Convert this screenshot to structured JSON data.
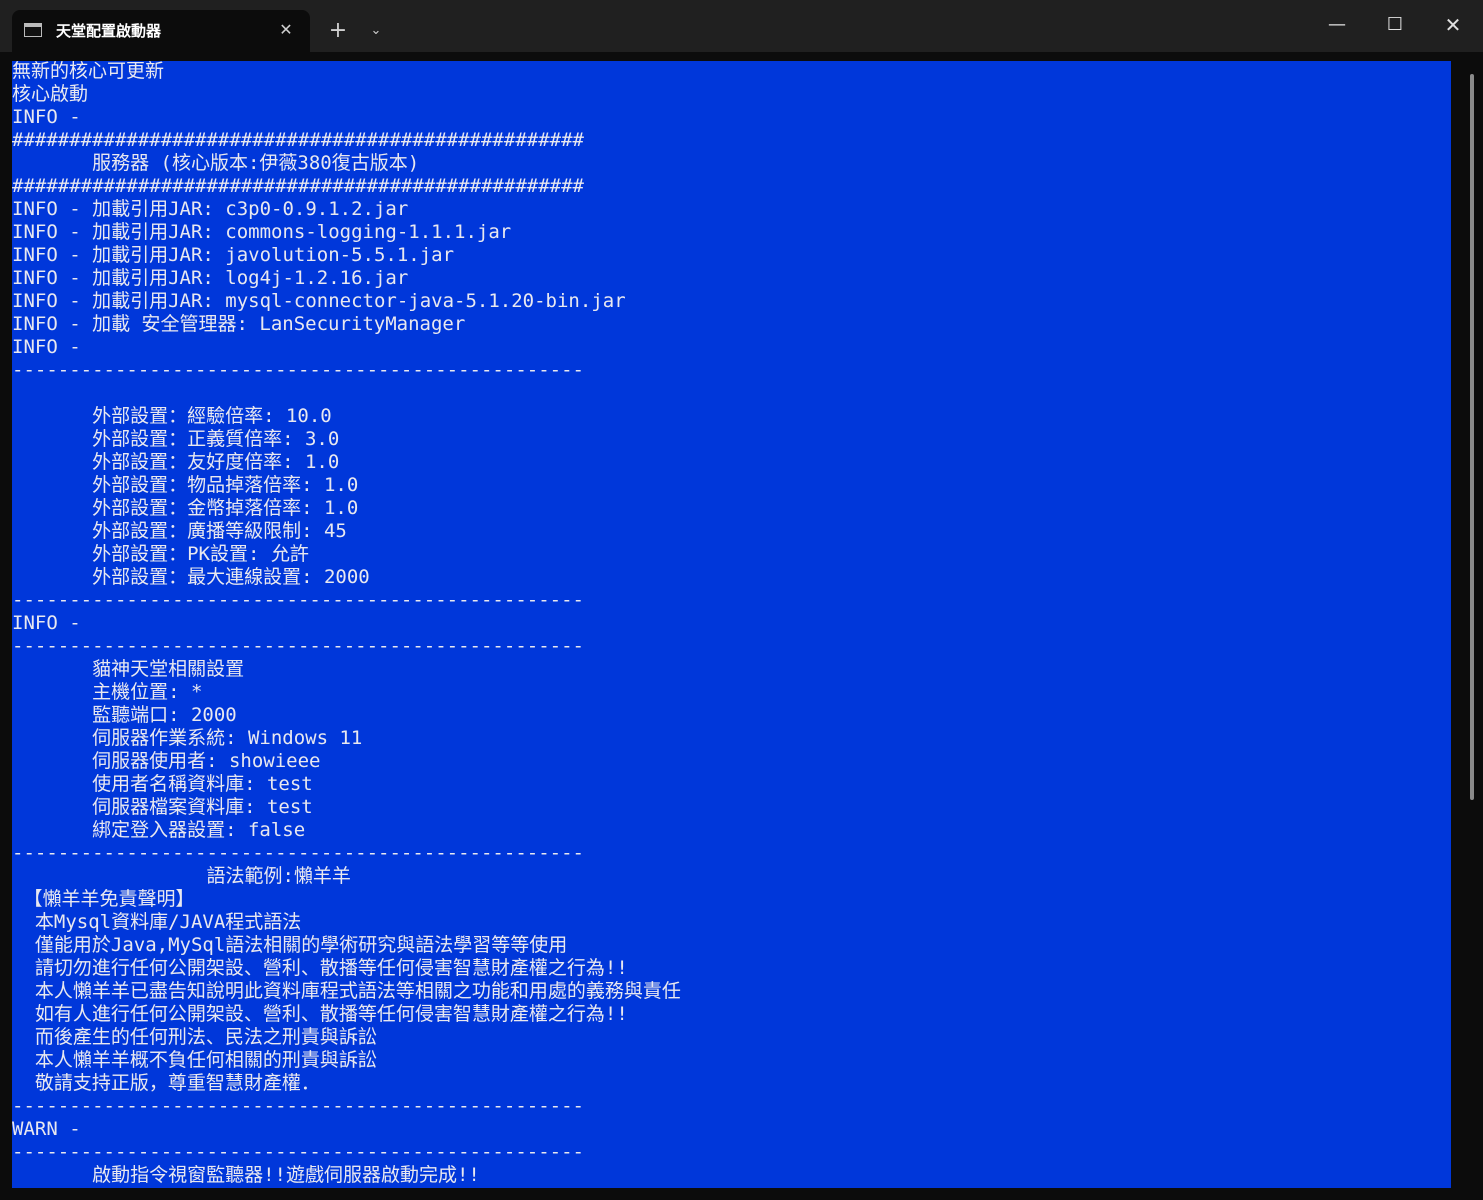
{
  "titlebar": {
    "tab_title": "天堂配置啟動器",
    "tab_icon": "terminal-icon",
    "tab_close_glyph": "✕",
    "new_tab_glyph": "+",
    "dropdown_glyph": "⌄",
    "minimize_glyph": "—",
    "maximize_glyph": "☐",
    "close_glyph": "✕"
  },
  "console": {
    "background_color": "#0037da",
    "text_color": "#e8e8f0",
    "lines": [
      "無新的核心可更新",
      "核心啟動",
      "INFO -",
      "##################################################",
      "       服務器 (核心版本:伊薇380復古版本)",
      "##################################################",
      "INFO - 加載引用JAR: c3p0-0.9.1.2.jar",
      "INFO - 加載引用JAR: commons-logging-1.1.1.jar",
      "INFO - 加載引用JAR: javolution-5.5.1.jar",
      "INFO - 加載引用JAR: log4j-1.2.16.jar",
      "INFO - 加載引用JAR: mysql-connector-java-5.1.20-bin.jar",
      "INFO - 加載 安全管理器: LanSecurityManager",
      "INFO -",
      "--------------------------------------------------",
      "",
      "       外部設置：經驗倍率: 10.0",
      "       外部設置：正義質倍率: 3.0",
      "       外部設置：友好度倍率: 1.0",
      "       外部設置：物品掉落倍率: 1.0",
      "       外部設置：金幣掉落倍率: 1.0",
      "       外部設置：廣播等級限制: 45",
      "       外部設置：PK設置: 允許",
      "       外部設置：最大連線設置: 2000",
      "--------------------------------------------------",
      "INFO -",
      "--------------------------------------------------",
      "       貓神天堂相關設置",
      "       主機位置: *",
      "       監聽端口: 2000",
      "       伺服器作業系統: Windows 11",
      "       伺服器使用者: showieee",
      "       使用者名稱資料庫: test",
      "       伺服器檔案資料庫: test",
      "       綁定登入器設置: false",
      "--------------------------------------------------",
      "                 語法範例:懶羊羊",
      " 【懶羊羊免責聲明】",
      "  本Mysql資料庫/JAVA程式語法",
      "  僅能用於Java,MySql語法相關的學術研究與語法學習等等使用",
      "  請切勿進行任何公開架設、營利、散播等任何侵害智慧財產權之行為!!",
      "  本人懶羊羊已盡告知說明此資料庫程式語法等相關之功能和用處的義務與責任",
      "  如有人進行任何公開架設、營利、散播等任何侵害智慧財產權之行為!!",
      "  而後產生的任何刑法、民法之刑責與訴訟",
      "  本人懶羊羊概不負任何相關的刑責與訴訟",
      "  敬請支持正版，尊重智慧財產權．",
      "--------------------------------------------------",
      "WARN -",
      "--------------------------------------------------",
      "       啟動指令視窗監聽器!!遊戲伺服器啟動完成!!"
    ]
  }
}
